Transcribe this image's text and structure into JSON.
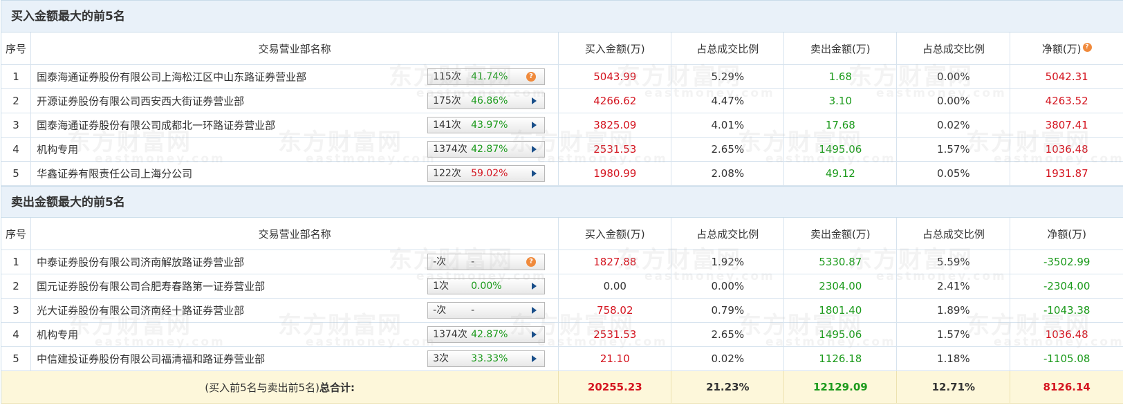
{
  "buy_section": {
    "title": "买入金额最大的前5名",
    "headers": [
      "序号",
      "交易营业部名称",
      "买入金额(万)",
      "占总成交比例",
      "卖出金额(万)",
      "占总成交比例",
      "净额(万)"
    ],
    "net_help_icon": "question-icon",
    "rows": [
      {
        "idx": "1",
        "name": "国泰海通证券股份有限公司上海松江区中山东路证券营业部",
        "count": "115次",
        "rate": "41.74%",
        "rate_color": "green",
        "icon": "question-icon",
        "buy": "5043.99",
        "buy_pct": "5.29%",
        "sell": "1.68",
        "sell_pct": "0.00%",
        "net": "5042.31",
        "net_color": "red"
      },
      {
        "idx": "2",
        "name": "开源证券股份有限公司西安西大街证券营业部",
        "count": "175次",
        "rate": "46.86%",
        "rate_color": "green",
        "icon": "arrow-right-icon",
        "buy": "4266.62",
        "buy_pct": "4.47%",
        "sell": "3.10",
        "sell_pct": "0.00%",
        "net": "4263.52",
        "net_color": "red"
      },
      {
        "idx": "3",
        "name": "国泰海通证券股份有限公司成都北一环路证券营业部",
        "count": "141次",
        "rate": "43.97%",
        "rate_color": "green",
        "icon": "arrow-right-icon",
        "buy": "3825.09",
        "buy_pct": "4.01%",
        "sell": "17.68",
        "sell_pct": "0.02%",
        "net": "3807.41",
        "net_color": "red"
      },
      {
        "idx": "4",
        "name": "机构专用",
        "count": "1374次",
        "rate": "42.87%",
        "rate_color": "green",
        "icon": "arrow-right-icon",
        "buy": "2531.53",
        "buy_pct": "2.65%",
        "sell": "1495.06",
        "sell_pct": "1.57%",
        "net": "1036.48",
        "net_color": "red"
      },
      {
        "idx": "5",
        "name": "华鑫证券有限责任公司上海分公司",
        "count": "122次",
        "rate": "59.02%",
        "rate_color": "red",
        "icon": "arrow-right-icon",
        "buy": "1980.99",
        "buy_pct": "2.08%",
        "sell": "49.12",
        "sell_pct": "0.05%",
        "net": "1931.87",
        "net_color": "red"
      }
    ]
  },
  "sell_section": {
    "title": "卖出金额最大的前5名",
    "headers": [
      "序号",
      "交易营业部名称",
      "买入金额(万)",
      "占总成交比例",
      "卖出金额(万)",
      "占总成交比例",
      "净额(万)"
    ],
    "rows": [
      {
        "idx": "1",
        "name": "中泰证券股份有限公司济南解放路证券营业部",
        "count": "-次",
        "rate": "-",
        "rate_color": "plain",
        "icon": "question-icon",
        "buy": "1827.88",
        "buy_color": "red",
        "buy_pct": "1.92%",
        "sell": "5330.87",
        "sell_pct": "5.59%",
        "net": "-3502.99",
        "net_color": "green"
      },
      {
        "idx": "2",
        "name": "国元证券股份有限公司合肥寿春路第一证券营业部",
        "count": "1次",
        "rate": "0.00%",
        "rate_color": "green",
        "icon": "arrow-right-icon",
        "buy": "0.00",
        "buy_color": "plain",
        "buy_pct": "0.00%",
        "sell": "2304.00",
        "sell_pct": "2.41%",
        "net": "-2304.00",
        "net_color": "green"
      },
      {
        "idx": "3",
        "name": "光大证券股份有限公司济南经十路证券营业部",
        "count": "-次",
        "rate": "-",
        "rate_color": "plain",
        "icon": "arrow-right-icon",
        "buy": "758.02",
        "buy_color": "red",
        "buy_pct": "0.79%",
        "sell": "1801.40",
        "sell_pct": "1.89%",
        "net": "-1043.38",
        "net_color": "green"
      },
      {
        "idx": "4",
        "name": "机构专用",
        "count": "1374次",
        "rate": "42.87%",
        "rate_color": "green",
        "icon": "arrow-right-icon",
        "buy": "2531.53",
        "buy_color": "red",
        "buy_pct": "2.65%",
        "sell": "1495.06",
        "sell_pct": "1.57%",
        "net": "1036.48",
        "net_color": "red"
      },
      {
        "idx": "5",
        "name": "中信建投证券股份有限公司福清福和路证券营业部",
        "count": "3次",
        "rate": "33.33%",
        "rate_color": "green",
        "icon": "arrow-right-icon",
        "buy": "21.10",
        "buy_color": "red",
        "buy_pct": "0.02%",
        "sell": "1126.18",
        "sell_pct": "1.18%",
        "net": "-1105.08",
        "net_color": "green"
      }
    ]
  },
  "total": {
    "label_prefix": "(买入前5名与卖出前5名)",
    "label_bold": "总合计:",
    "buy": "20255.23",
    "buy_pct": "21.23%",
    "sell": "12129.09",
    "sell_pct": "12.71%",
    "net": "8126.14"
  },
  "watermark": {
    "text": "东方财富网",
    "sub": "eastmoney.com"
  },
  "colors": {
    "red": "#d4141f",
    "green": "#1b9a1b",
    "header_bg": "#e9f1f9",
    "total_bg": "#fdf7da",
    "help_icon": "#f08a3c",
    "arrow": "#1a4f8a"
  }
}
